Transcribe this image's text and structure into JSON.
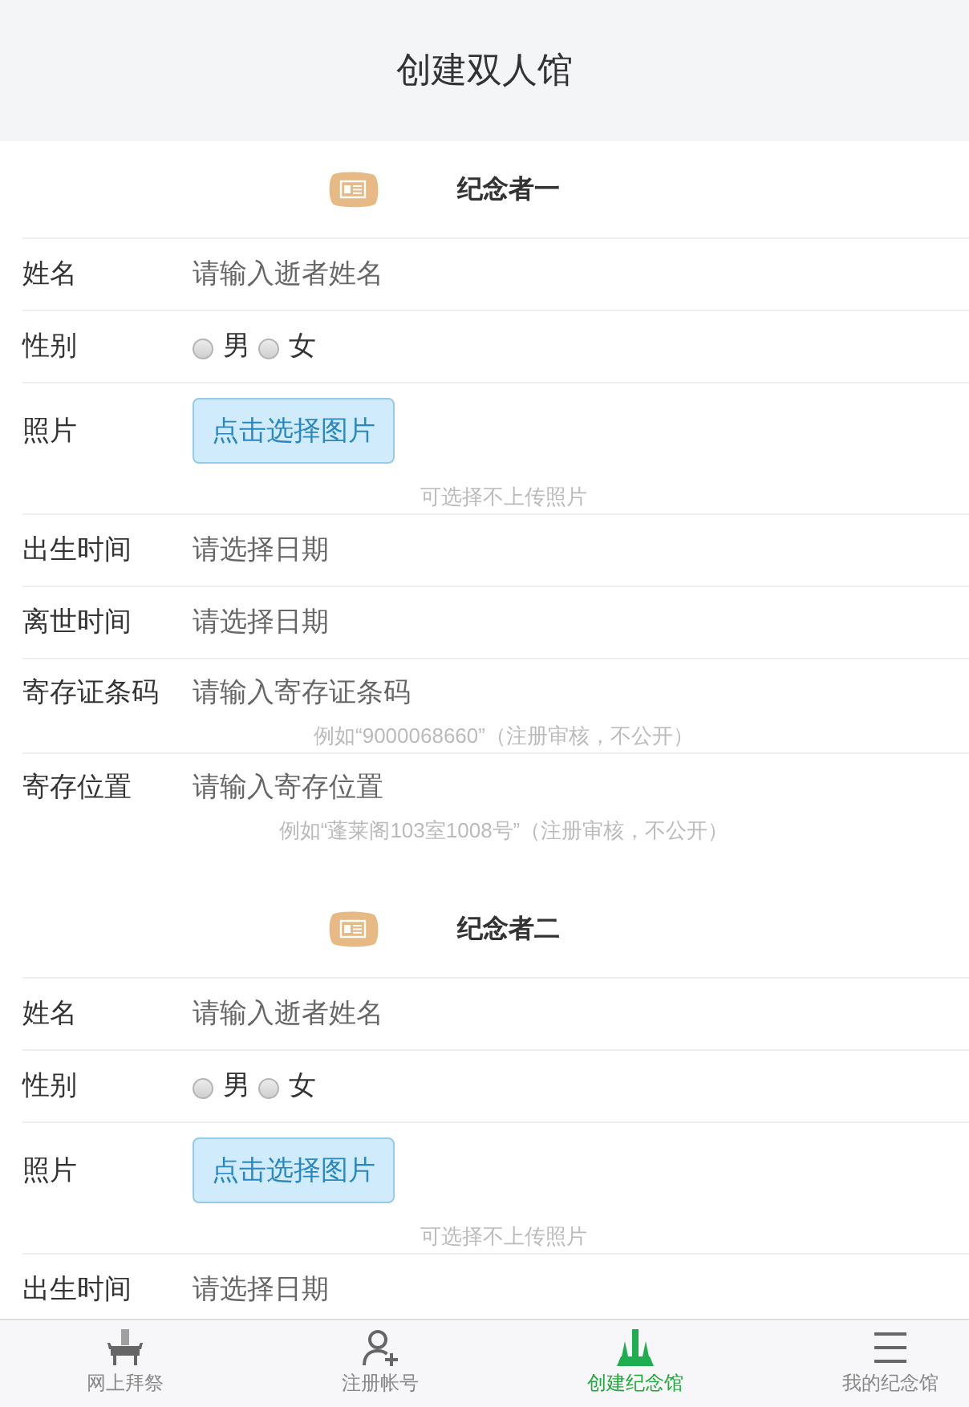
{
  "header": {
    "title": "创建双人馆"
  },
  "sections": [
    {
      "title": "纪念者一",
      "fields": [
        {
          "kind": "input",
          "label": "姓名",
          "placeholder": "请输入逝者姓名"
        },
        {
          "kind": "radio",
          "label": "性别",
          "options": [
            {
              "label": "男",
              "selected": false
            },
            {
              "label": "女",
              "selected": false
            }
          ]
        },
        {
          "kind": "upload",
          "label": "照片",
          "button": "点击选择图片",
          "hint": "可选择不上传照片"
        },
        {
          "kind": "input",
          "label": "出生时间",
          "placeholder": "请选择日期"
        },
        {
          "kind": "input",
          "label": "离世时间",
          "placeholder": "请选择日期"
        },
        {
          "kind": "input",
          "label": "寄存证条码",
          "placeholder": "请输入寄存证条码",
          "hint": "例如“9000068660”（注册审核，不公开）"
        },
        {
          "kind": "input",
          "label": "寄存位置",
          "placeholder": "请输入寄存位置",
          "hint": "例如“蓬莱阁103室1008号”（注册审核，不公开）"
        }
      ]
    },
    {
      "title": "纪念者二",
      "fields": [
        {
          "kind": "input",
          "label": "姓名",
          "placeholder": "请输入逝者姓名"
        },
        {
          "kind": "radio",
          "label": "性别",
          "options": [
            {
              "label": "男",
              "selected": false
            },
            {
              "label": "女",
              "selected": false
            }
          ]
        },
        {
          "kind": "upload",
          "label": "照片",
          "button": "点击选择图片",
          "hint": "可选择不上传照片"
        },
        {
          "kind": "input",
          "label": "出生时间",
          "placeholder": "请选择日期"
        }
      ]
    }
  ],
  "tab_bar": [
    {
      "kind": "altar",
      "label": "网上拜祭",
      "selected": false
    },
    {
      "kind": "add-user",
      "label": "注册帐号",
      "selected": false
    },
    {
      "kind": "monument",
      "label": "创建纪念馆",
      "selected": true
    },
    {
      "kind": "menu",
      "label": "我的纪念馆",
      "selected": false
    }
  ]
}
